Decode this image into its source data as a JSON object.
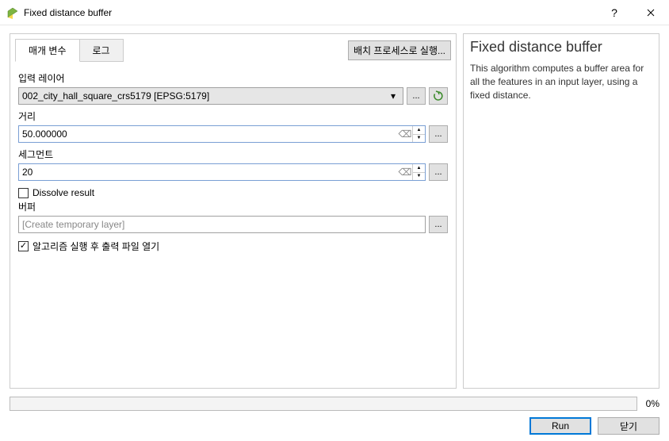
{
  "window": {
    "title": "Fixed distance buffer",
    "help_symbol": "?",
    "close_symbol": "×"
  },
  "tabs": {
    "params": "매개 변수",
    "log": "로그"
  },
  "batch_button": "배치 프로세스로 실행...",
  "form": {
    "input_layer_label": "입력 레이어",
    "input_layer_value": "002_city_hall_square_crs5179 [EPSG:5179]",
    "distance_label": "거리",
    "distance_value": "50.000000",
    "segments_label": "세그먼트",
    "segments_value": "20",
    "dissolve_label": "Dissolve result",
    "dissolve_checked": false,
    "buffer_label": "버퍼",
    "buffer_placeholder": "[Create temporary layer]",
    "open_output_label": "알고리즘 실행 후 출력 파일 열기",
    "open_output_checked": true,
    "ellipsis": "...",
    "clear_symbol": "⌫"
  },
  "help": {
    "title": "Fixed distance buffer",
    "description": "This algorithm computes a buffer area for all the features in an input layer, using a fixed distance."
  },
  "progress": {
    "percent": "0%"
  },
  "buttons": {
    "run": "Run",
    "close": "닫기"
  }
}
